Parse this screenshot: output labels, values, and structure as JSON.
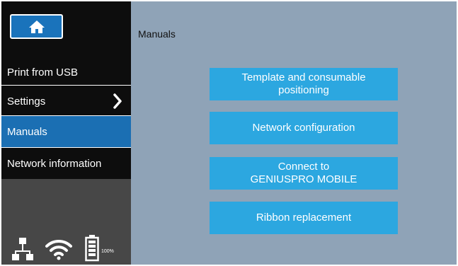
{
  "sidebar": {
    "items": [
      {
        "label": "Print from USB"
      },
      {
        "label": "Settings"
      },
      {
        "label": "Manuals"
      },
      {
        "label": "Network information"
      }
    ],
    "status": {
      "battery_label": "100%",
      "battery_level": 1.0
    }
  },
  "main": {
    "title": "Manuals",
    "buttons": [
      {
        "line1": "Template and consumable",
        "line2": "positioning"
      },
      {
        "line1": "Network configuration",
        "line2": ""
      },
      {
        "line1": "Connect to",
        "line2": "GENIUSPRO MOBILE"
      },
      {
        "line1": "Ribbon replacement",
        "line2": ""
      }
    ]
  },
  "colors": {
    "accent": "#2ca7e0",
    "active_nav": "#1b6fb3",
    "background": "#8fa3b7"
  }
}
